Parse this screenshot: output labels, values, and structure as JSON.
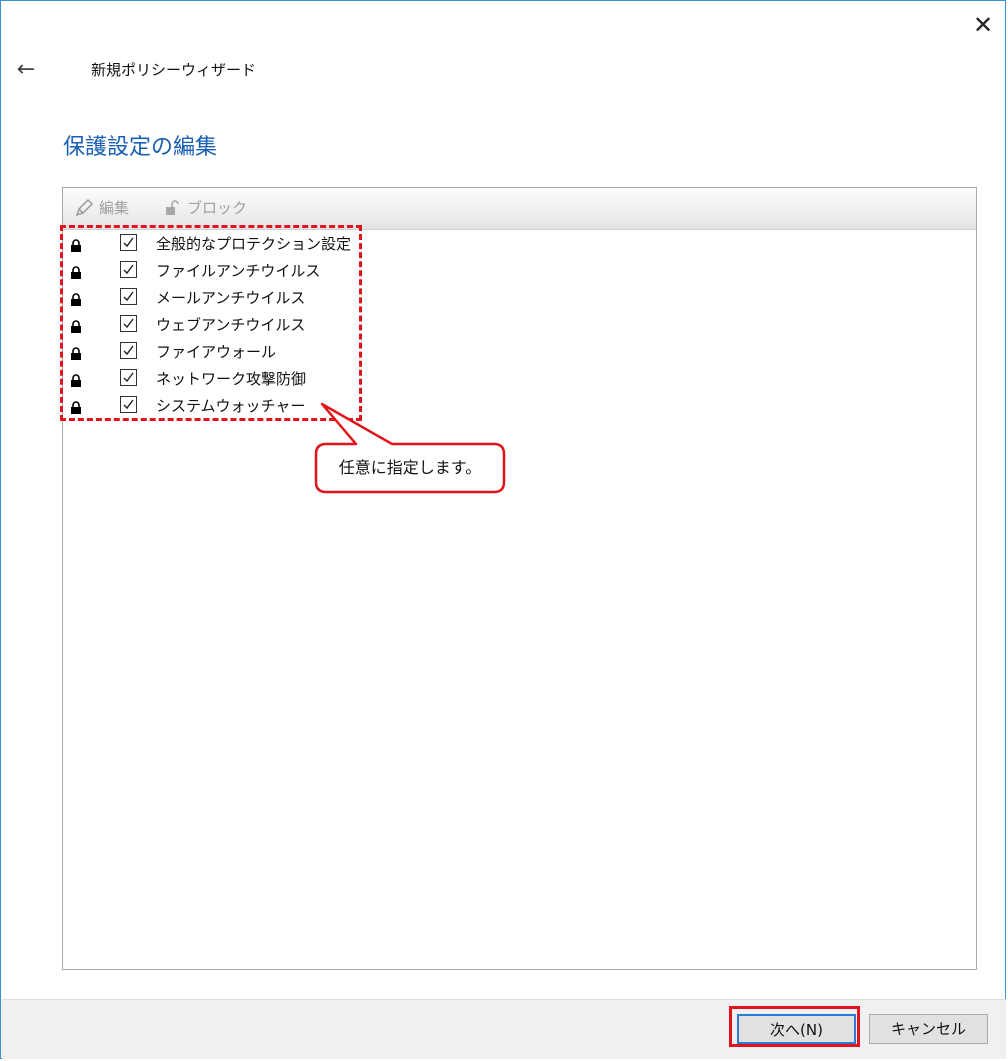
{
  "window": {
    "close_glyph": "✕",
    "back_glyph": "←",
    "wizard_title": "新規ポリシーウィザード"
  },
  "page": {
    "heading": "保護設定の編集"
  },
  "toolbar": {
    "edit_label": "編集",
    "block_label": "ブロック"
  },
  "components": [
    {
      "label": "全般的なプロテクション設定",
      "checked": true,
      "locked": true
    },
    {
      "label": "ファイルアンチウイルス",
      "checked": true,
      "locked": true
    },
    {
      "label": "メールアンチウイルス",
      "checked": true,
      "locked": true
    },
    {
      "label": "ウェブアンチウイルス",
      "checked": true,
      "locked": true
    },
    {
      "label": "ファイアウォール",
      "checked": true,
      "locked": true
    },
    {
      "label": "ネットワーク攻撃防御",
      "checked": true,
      "locked": true
    },
    {
      "label": "システムウォッチャー",
      "checked": true,
      "locked": true
    }
  ],
  "annotation": {
    "callout_text": "任意に指定します。",
    "color": "#e0151b"
  },
  "footer": {
    "next_label": "次へ(N)",
    "cancel_label": "キャンセル"
  },
  "colors": {
    "heading": "#1a5fb4",
    "window_border": "#3a8fd6",
    "accent_button_border": "#2c7bd3"
  }
}
